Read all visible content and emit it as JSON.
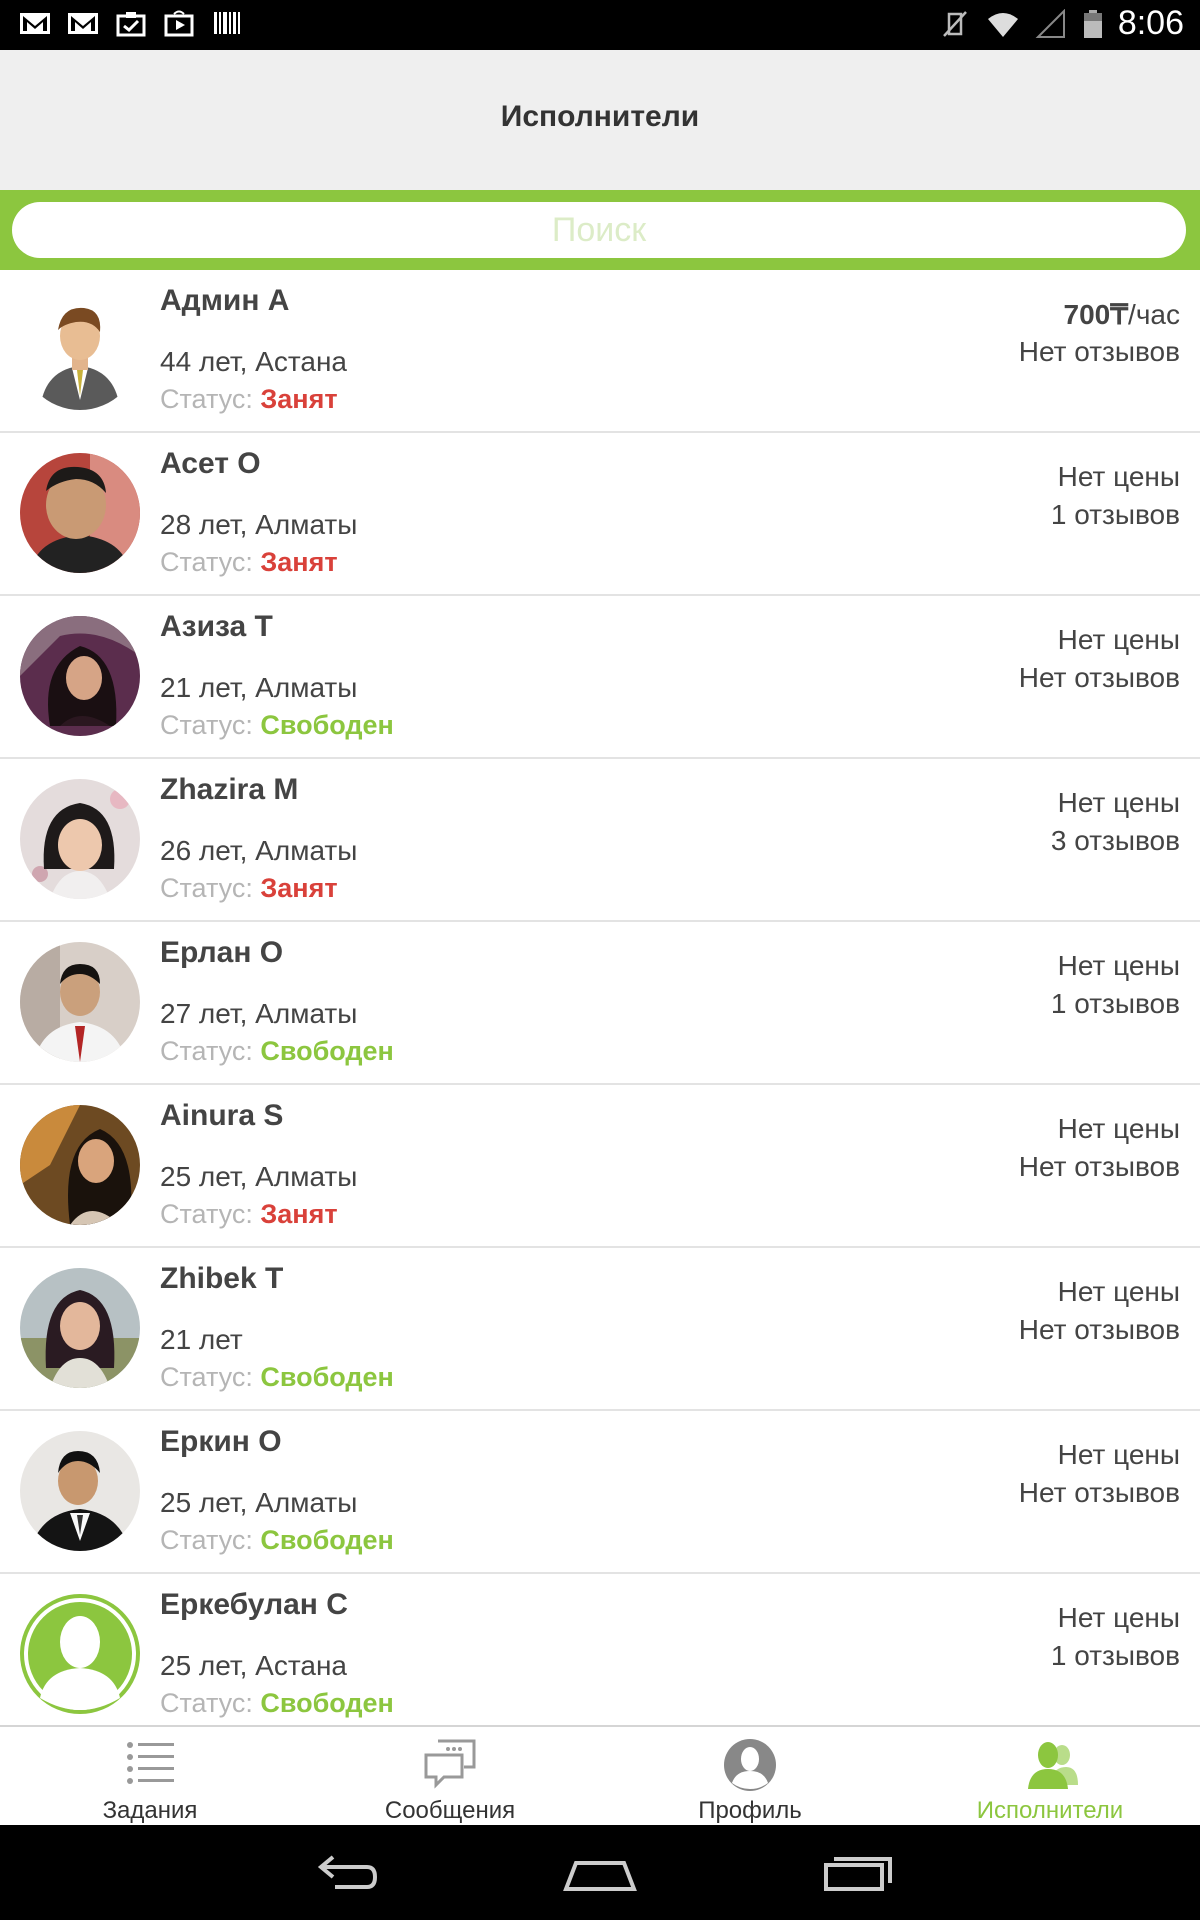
{
  "status_bar": {
    "time": "8:06",
    "left_icons": [
      "gmail-icon",
      "gmail-icon",
      "clipboard-check-icon",
      "play-store-icon",
      "barcode-icon"
    ],
    "right_icons": [
      "vibrate-off-icon",
      "wifi-icon",
      "signal-icon",
      "battery-icon"
    ]
  },
  "header": {
    "title": "Исполнители"
  },
  "search": {
    "placeholder": "Поиск",
    "value": ""
  },
  "status_prefix": "Статус: ",
  "performers": [
    {
      "name": "Админ А",
      "info": "44 лет, Астана",
      "status": "Занят",
      "status_type": "busy",
      "price_value": "700₸",
      "price_unit": "/час",
      "reviews": "Нет отзывов",
      "avatar": "cartoon-businessman"
    },
    {
      "name": "Асет О",
      "info": "28 лет, Алматы",
      "status": "Занят",
      "status_type": "busy",
      "price_value": "",
      "price_unit": "Нет цены",
      "reviews": "1 отзывов",
      "avatar": "photo"
    },
    {
      "name": "Азиза Т",
      "info": "21 лет, Алматы",
      "status": "Свободен",
      "status_type": "free",
      "price_value": "",
      "price_unit": "Нет цены",
      "reviews": "Нет отзывов",
      "avatar": "photo"
    },
    {
      "name": "Zhazira M",
      "info": "26 лет, Алматы",
      "status": "Занят",
      "status_type": "busy",
      "price_value": "",
      "price_unit": "Нет цены",
      "reviews": "3 отзывов",
      "avatar": "photo"
    },
    {
      "name": "Ерлан О",
      "info": "27 лет, Алматы",
      "status": "Свободен",
      "status_type": "free",
      "price_value": "",
      "price_unit": "Нет цены",
      "reviews": "1 отзывов",
      "avatar": "photo"
    },
    {
      "name": "Ainura S",
      "info": "25 лет, Алматы",
      "status": "Занят",
      "status_type": "busy",
      "price_value": "",
      "price_unit": "Нет цены",
      "reviews": "Нет отзывов",
      "avatar": "photo"
    },
    {
      "name": "Zhibek T",
      "info": "21 лет",
      "status": "Свободен",
      "status_type": "free",
      "price_value": "",
      "price_unit": "Нет цены",
      "reviews": "Нет отзывов",
      "avatar": "photo"
    },
    {
      "name": "Еркин О",
      "info": "25 лет, Алматы",
      "status": "Свободен",
      "status_type": "free",
      "price_value": "",
      "price_unit": "Нет цены",
      "reviews": "Нет отзывов",
      "avatar": "photo"
    },
    {
      "name": "Еркебулан С",
      "info": "25 лет, Астана",
      "status": "Свободен",
      "status_type": "free",
      "price_value": "",
      "price_unit": "Нет цены",
      "reviews": "1 отзывов",
      "avatar": "default-silhouette"
    }
  ],
  "bottom_nav": [
    {
      "label": "Задания",
      "icon": "task-list-icon",
      "active": false
    },
    {
      "label": "Сообщения",
      "icon": "chat-bubble-icon",
      "active": false
    },
    {
      "label": "Профиль",
      "icon": "profile-icon",
      "active": false
    },
    {
      "label": "Исполнители",
      "icon": "performers-icon",
      "active": true
    }
  ],
  "system_nav": [
    "back-icon",
    "home-icon",
    "recent-apps-icon"
  ],
  "colors": {
    "accent": "#8cc63f",
    "busy": "#d9413a",
    "statusbar": "#000000",
    "appbar": "#efefef"
  }
}
